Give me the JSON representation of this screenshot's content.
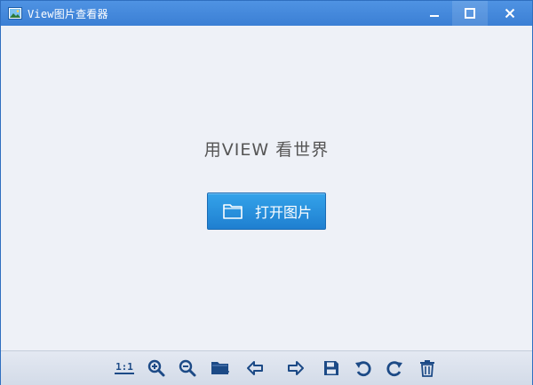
{
  "window": {
    "title": "View图片查看器"
  },
  "main": {
    "slogan": "用VIEW 看世界",
    "open_button_label": "打开图片"
  },
  "toolbar": {
    "actual_size_label": "1:1",
    "items": [
      "actual-size-icon",
      "zoom-in-icon",
      "zoom-out-icon",
      "open-folder-icon",
      "previous-icon",
      "next-icon",
      "save-icon",
      "rotate-left-icon",
      "rotate-right-icon",
      "delete-icon"
    ]
  },
  "colors": {
    "titlebar": "#3b7fd4",
    "accent": "#1f7fd0",
    "icon": "#1c4a86",
    "background": "#eef1f7"
  }
}
